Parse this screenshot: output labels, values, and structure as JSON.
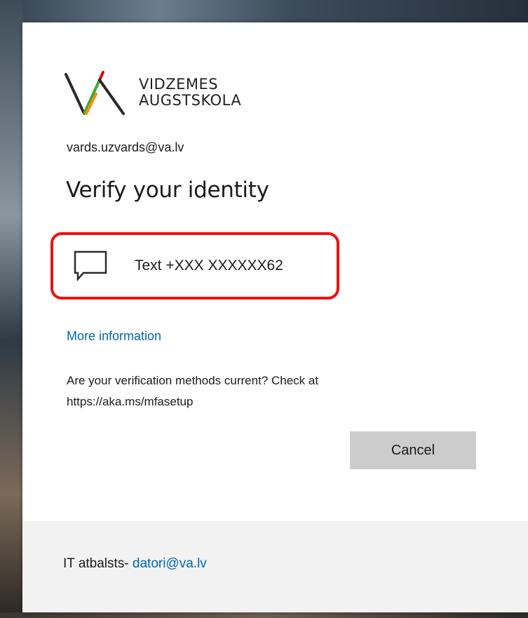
{
  "logo": {
    "line1": "VIDZEMES",
    "line2": "AUGSTSKOLA",
    "colors": {
      "dark": "#2a2a2a",
      "green": "#3aa935",
      "orange": "#f39200",
      "red": "#e30613"
    }
  },
  "account": {
    "email": "vards.uzvards@va.lv"
  },
  "heading": "Verify your identity",
  "method": {
    "icon": "chat-bubble-icon",
    "label": "Text +XXX XXXXXX62",
    "highlight_color": "#ee1111"
  },
  "more_info": "More information",
  "note": "Are your verification methods current? Check at https://aka.ms/mfasetup",
  "cancel_label": "Cancel",
  "footer": {
    "prefix": "IT atbalsts- ",
    "link": "datori@va.lv"
  },
  "colors": {
    "link": "#0067b8",
    "button": "#cccccc",
    "footer_bg": "#f2f2f2"
  }
}
